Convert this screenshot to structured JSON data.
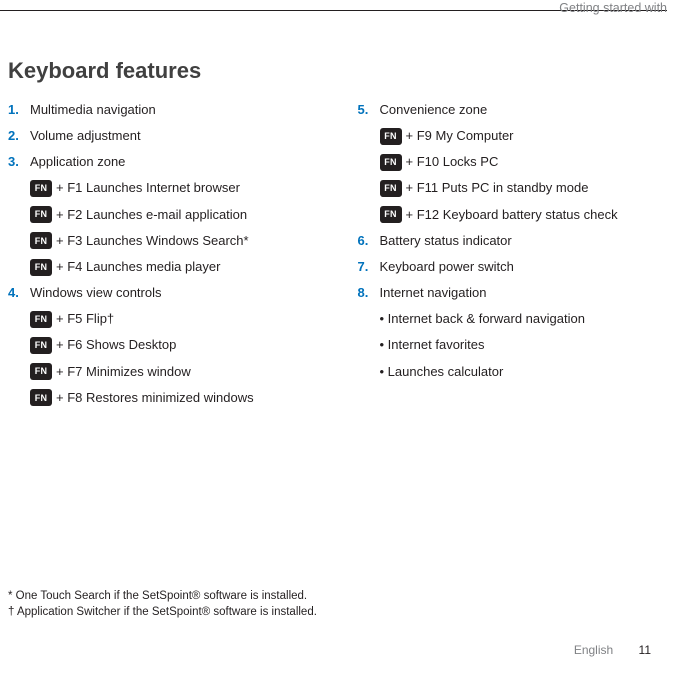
{
  "running_head": "Getting started with",
  "title": "Keyboard features",
  "fn_label": "FN",
  "left": {
    "i1": {
      "n": "1.",
      "t": "Multimedia navigation"
    },
    "i2": {
      "n": "2.",
      "t": " Volume adjustment"
    },
    "i3": {
      "n": "3.",
      "t": "Application zone"
    },
    "i3a": "+ F1 Launches Internet browser",
    "i3b": "+ F2 Launches e-mail application",
    "i3c": "+ F3 Launches Windows Search*",
    "i3d": "+ F4 Launches media player",
    "i4": {
      "n": "4.",
      "t": "Windows view controls"
    },
    "i4a": "+ F5 Flip†",
    "i4b": "+ F6 Shows Desktop",
    "i4c": "+ F7 Minimizes window",
    "i4d": "+ F8 Restores minimized windows"
  },
  "right": {
    "i5": {
      "n": "5.",
      "t": "Convenience zone"
    },
    "i5a": "+ F9 My Computer",
    "i5b": "+ F10 Locks PC",
    "i5c": "+ F11 Puts PC in standby mode",
    "i5d": "+ F12 Keyboard battery status check",
    "i6": {
      "n": "6.",
      "t": "Battery status indicator"
    },
    "i7": {
      "n": "7.",
      "t": "Keyboard power switch"
    },
    "i8": {
      "n": "8.",
      "t": "Internet navigation"
    },
    "i8a": "• Internet back & forward navigation",
    "i8b": "• Internet favorites",
    "i8c": "• Launches calculator"
  },
  "footnotes": {
    "a": "* One Touch Search if the SetSpoint® software is installed.",
    "b": "† Application Switcher  if the SetSpoint® software is installed."
  },
  "footer": {
    "lang": "English",
    "page": "11"
  }
}
